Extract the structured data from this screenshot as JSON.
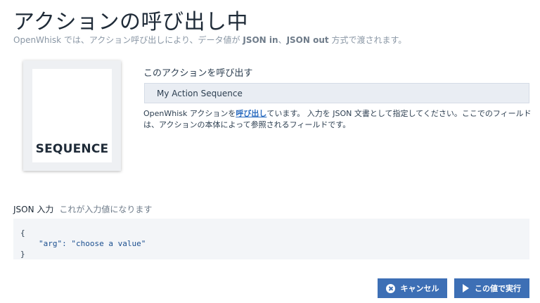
{
  "header": {
    "title": "アクションの呼び出し中",
    "subtitle_prefix": "OpenWhisk では、アクション呼び出しにより、データ値が ",
    "subtitle_json_in": "JSON in",
    "subtitle_sep": "、",
    "subtitle_json_out": "JSON out",
    "subtitle_suffix": " 方式で渡されます。"
  },
  "card": {
    "label": "SEQUENCE"
  },
  "invoke": {
    "label": "このアクションを呼び出す",
    "action_name": "My Action Sequence",
    "desc_prefix": "OpenWhisk アクションを",
    "desc_link": "呼び出し",
    "desc_suffix": "ています。 入力を JSON 文書として指定してください。ここでのフィールドは、アクションの本体によって参照されるフィールドです。"
  },
  "json_input": {
    "label": "JSON 入力",
    "hint": "これが入力値になります",
    "line1": "{",
    "line2": "\"arg\": \"choose a value\"",
    "line3": "}"
  },
  "buttons": {
    "cancel": "キャンセル",
    "run": "この値で実行"
  },
  "colors": {
    "accent": "#3d6fb5",
    "link": "#2d6dc0",
    "field_bg": "#e9edf3"
  }
}
